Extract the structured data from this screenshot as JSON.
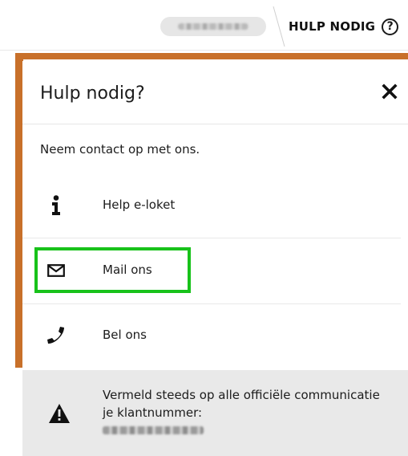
{
  "header": {
    "help_label": "HULP NODIG",
    "help_glyph": "?",
    "user_name_icon": "redacted-user-name"
  },
  "panel": {
    "title": "Hulp nodig?",
    "intro": "Neem contact op met ons.",
    "items": [
      {
        "icon": "info-icon",
        "label": "Help e-loket"
      },
      {
        "icon": "envelope-icon",
        "label": "Mail ons"
      },
      {
        "icon": "phone-icon",
        "label": "Bel ons"
      }
    ],
    "notice_text": "Vermeld steeds op alle officiële communicatie je klantnummer:",
    "notice_icon": "warning-icon"
  },
  "colors": {
    "accent_orange": "#c8702a",
    "highlight_green": "#18c21a",
    "notice_bg": "#e9e9e9"
  }
}
